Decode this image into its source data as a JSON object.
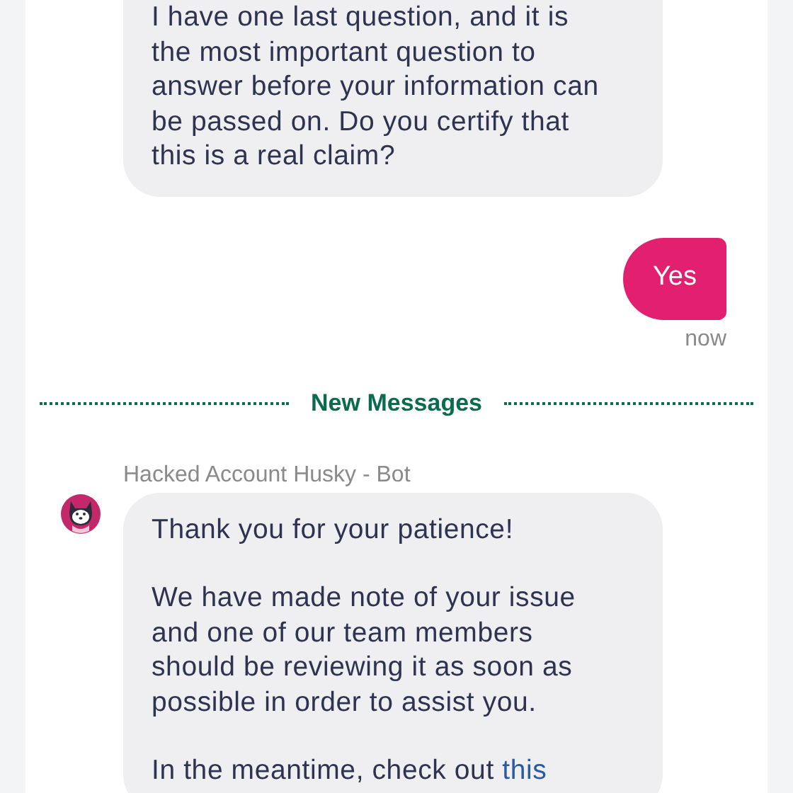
{
  "items": [
    {
      "kind": "bot_message",
      "paragraphs": [
        {
          "text": "I have one last question, and it is the most important question to answer before your information can be passed on. Do you certify that this is a real claim?"
        }
      ]
    },
    {
      "kind": "user_message",
      "text": "Yes",
      "time": "now"
    },
    {
      "kind": "divider",
      "label": "New Messages"
    },
    {
      "kind": "bot_message",
      "sender": "Hacked Account Husky - Bot",
      "avatar": true,
      "paragraphs": [
        {
          "text": "Thank you for your patience!"
        },
        {
          "text": "We have made note of your issue and one of our team members should be reviewing it as soon as possible in order to assist you."
        },
        {
          "text": "In the meantime, check out",
          "link": "this"
        }
      ]
    }
  ]
}
